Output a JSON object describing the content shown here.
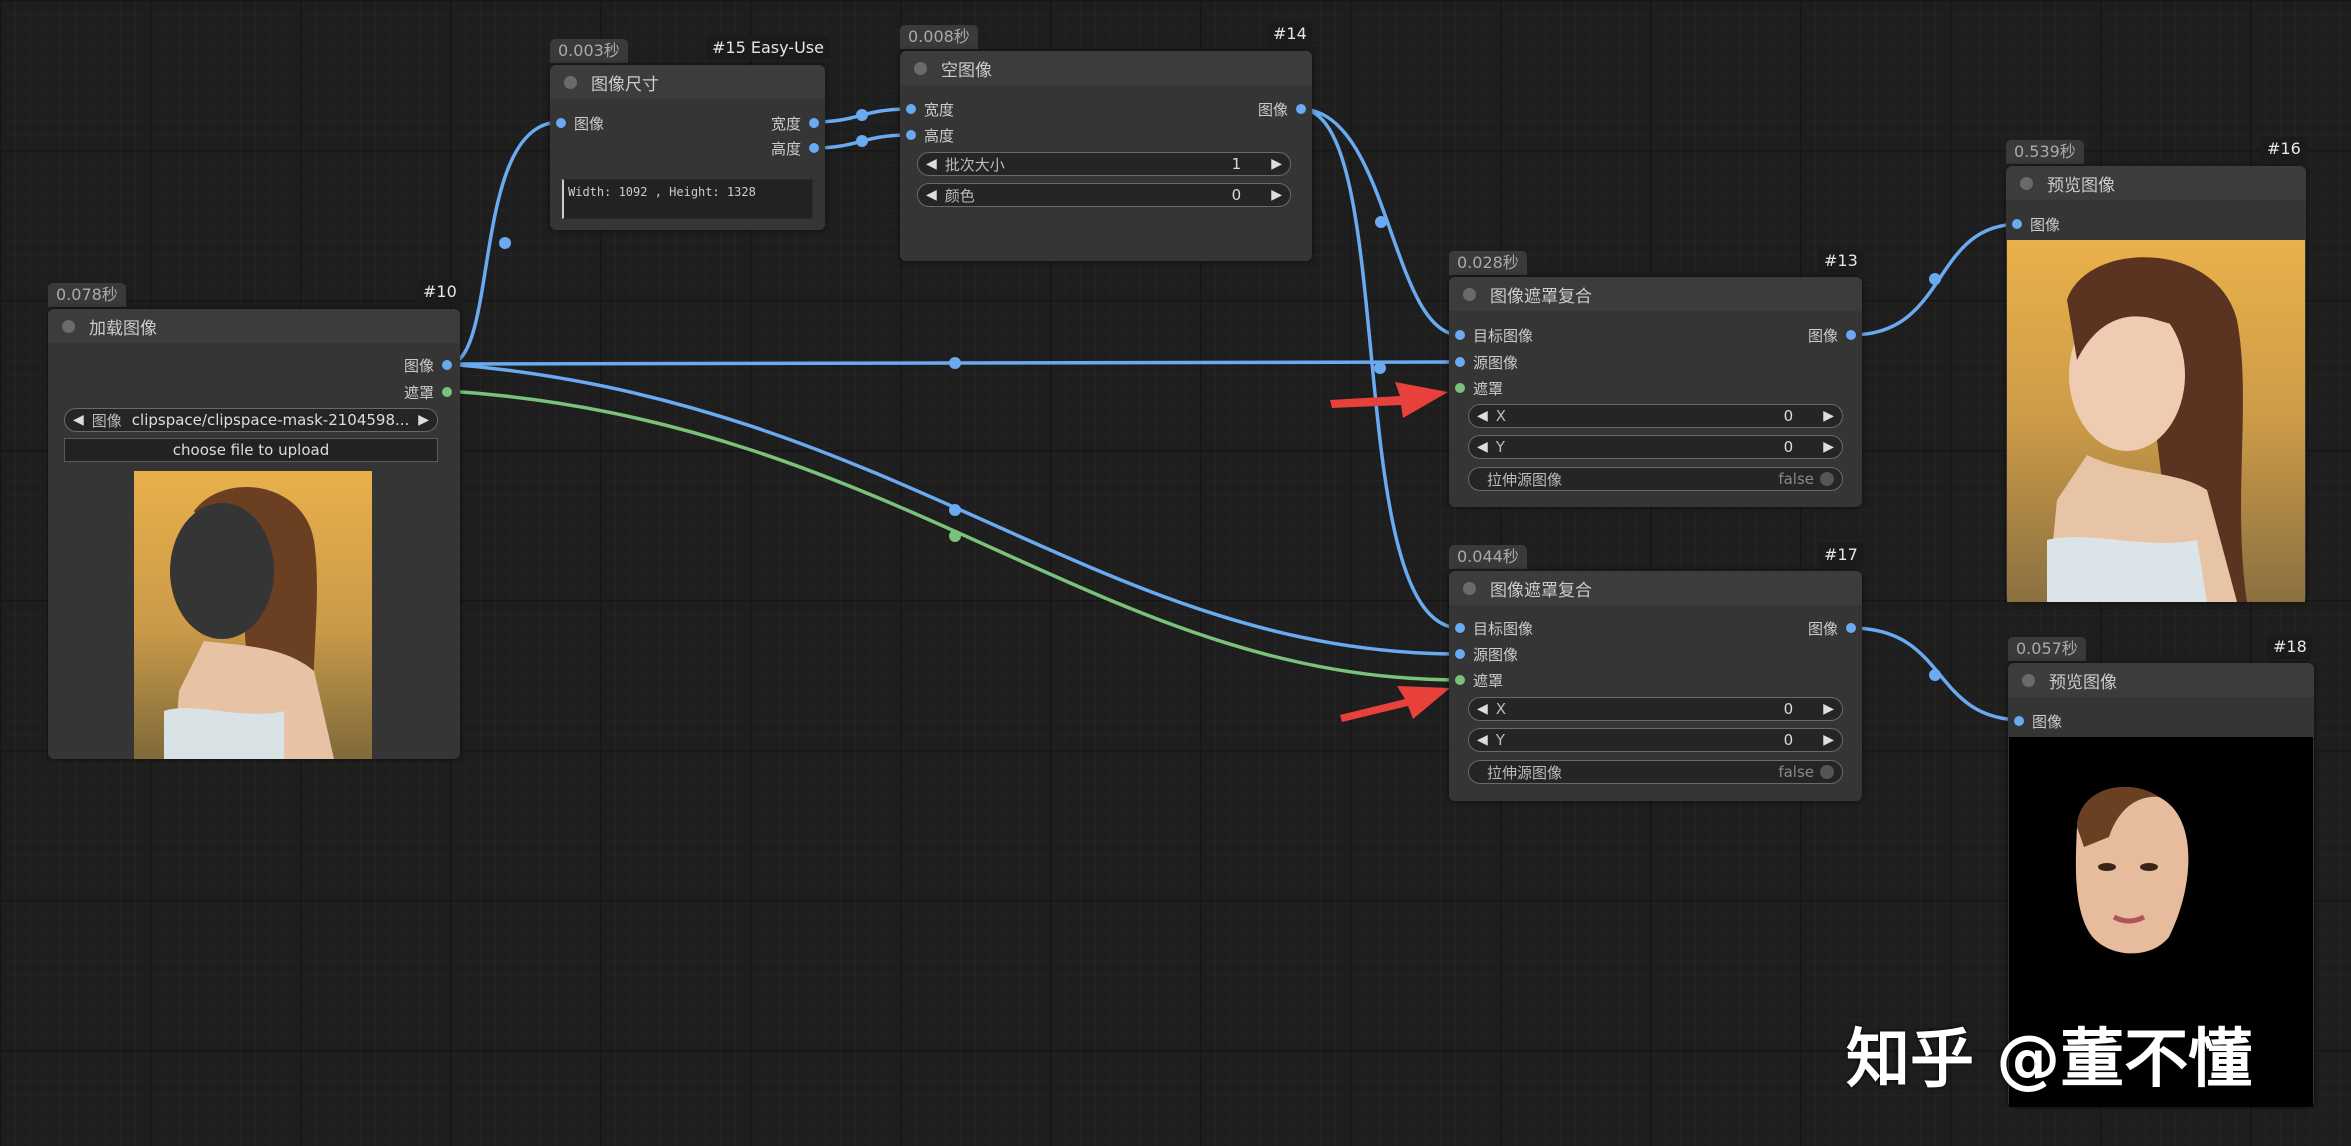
{
  "nodes": {
    "n10": {
      "time": "0.078秒",
      "id": "#10",
      "title": "加载图像",
      "outputs": {
        "image": "图像",
        "mask": "遮罩"
      },
      "image_widget": {
        "label": "图像",
        "value": "clipspace/clipspace-mask-2104598..."
      },
      "upload_label": "choose file to upload"
    },
    "n15": {
      "time": "0.003秒",
      "id": "#15 Easy-Use",
      "title": "图像尺寸",
      "input_image": "图像",
      "output_width": "宽度",
      "output_height": "高度",
      "text": "Width: 1092 , Height: 1328"
    },
    "n14": {
      "time": "0.008秒",
      "id": "#14",
      "title": "空图像",
      "input_width": "宽度",
      "input_height": "高度",
      "output_image": "图像",
      "w_batch": {
        "label": "批次大小",
        "value": "1"
      },
      "w_color": {
        "label": "颜色",
        "value": "0"
      }
    },
    "n13": {
      "time": "0.028秒",
      "id": "#13",
      "title": "图像遮罩复合",
      "in_target": "目标图像",
      "in_source": "源图像",
      "in_mask": "遮罩",
      "output_image": "图像",
      "w_x": {
        "label": "X",
        "value": "0"
      },
      "w_y": {
        "label": "Y",
        "value": "0"
      },
      "w_resize": {
        "label": "拉伸源图像",
        "value": "false"
      }
    },
    "n17": {
      "time": "0.044秒",
      "id": "#17",
      "title": "图像遮罩复合",
      "in_target": "目标图像",
      "in_source": "源图像",
      "in_mask": "遮罩",
      "output_image": "图像",
      "w_x": {
        "label": "X",
        "value": "0"
      },
      "w_y": {
        "label": "Y",
        "value": "0"
      },
      "w_resize": {
        "label": "拉伸源图像",
        "value": "false"
      }
    },
    "n16": {
      "time": "0.539秒",
      "id": "#16",
      "title": "预览图像",
      "input_image": "图像"
    },
    "n18": {
      "time": "0.057秒",
      "id": "#18",
      "title": "预览图像",
      "input_image": "图像"
    }
  },
  "watermark": "知乎 @董不懂",
  "colors": {
    "image_link": "#6aaaf0",
    "mask_link": "#7ac27a",
    "arrow": "#e8403a"
  }
}
